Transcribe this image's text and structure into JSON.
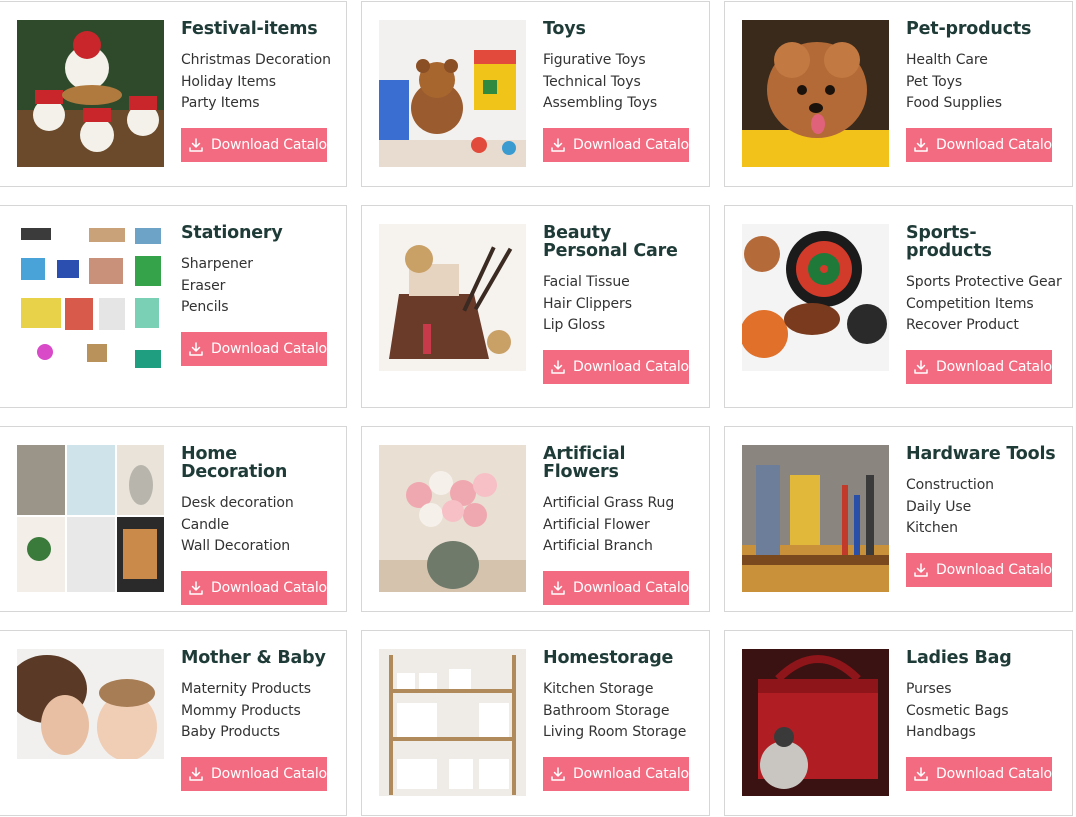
{
  "button_label": "Download Catalog",
  "colors": {
    "button": "#f26b81",
    "title": "#1f3b37",
    "border": "#d6d6d6"
  },
  "cards": [
    {
      "title": "Festival-items",
      "items": [
        "Christmas Decoration",
        "Holiday Items",
        "Party Items"
      ],
      "image": "christmas-snowmen-photo"
    },
    {
      "title": "Toys",
      "items": [
        "Figurative Toys",
        "Technical Toys",
        "Assembling Toys"
      ],
      "image": "toys-teddy-bear-photo"
    },
    {
      "title": "Pet-products",
      "items": [
        "Health Care",
        "Pet Toys",
        "Food Supplies"
      ],
      "image": "poodle-dog-photo"
    },
    {
      "title": "Stationery",
      "items": [
        "Sharpener",
        "Eraser",
        "Pencils"
      ],
      "image": "stationery-grid-photo"
    },
    {
      "title": "Beauty Personal Care",
      "items": [
        "Facial Tissue",
        "Hair Clippers",
        "Lip Gloss"
      ],
      "image": "cosmetics-bag-photo"
    },
    {
      "title": "Sports-products",
      "items": [
        "Sports Protective Gear",
        "Competition Items",
        "Recover Product"
      ],
      "image": "sports-balls-photo"
    },
    {
      "title": "Home Decoration",
      "items": [
        "Desk decoration",
        "Candle",
        "Wall Decoration"
      ],
      "image": "home-decor-collage-photo"
    },
    {
      "title": "Artificial Flowers",
      "items": [
        "Artificial Grass Rug",
        "Artificial Flower",
        "Artificial Branch"
      ],
      "image": "rose-vase-photo"
    },
    {
      "title": "Hardware Tools",
      "items": [
        "Construction",
        "Daily Use",
        "Kitchen"
      ],
      "image": "tool-belt-photo"
    },
    {
      "title": "Mother & Baby",
      "items": [
        "Maternity Products",
        "Mommy Products",
        "Baby Products"
      ],
      "image": "mother-baby-photo"
    },
    {
      "title": "Homestorage",
      "items": [
        "Kitchen Storage",
        "Bathroom Storage",
        "Living Room Storage"
      ],
      "image": "storage-shelf-photo"
    },
    {
      "title": "Ladies Bag",
      "items": [
        "Purses",
        "Cosmetic Bags",
        "Handbags"
      ],
      "image": "red-handbag-photo"
    }
  ]
}
